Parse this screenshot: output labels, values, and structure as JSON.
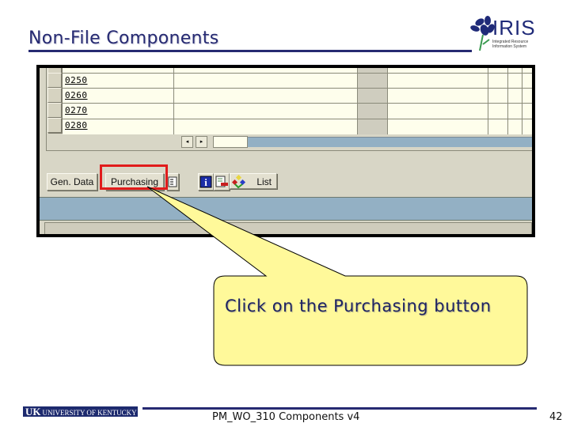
{
  "slide": {
    "title": "Non-File Components",
    "logo": {
      "name": "IRIS",
      "subtitle": "Integrated Resource Information System"
    }
  },
  "sap_screen": {
    "table": {
      "rows": [
        {
          "item": "0250"
        },
        {
          "item": "0260"
        },
        {
          "item": "0270"
        },
        {
          "item": "0280"
        }
      ]
    },
    "scroll": {
      "left_icon": "◂",
      "right_icon": "▸"
    },
    "buttons": {
      "gen_data": "Gen. Data",
      "purchasing": "Purchasing",
      "list": "List"
    },
    "icons": [
      "detail-icon",
      "info-icon",
      "delete-icon",
      "structure-icon"
    ]
  },
  "callout": {
    "text": "Click on the Purchasing button"
  },
  "footer": {
    "logo_abbrev": "UK",
    "logo_text": "UNIVERSITY OF KENTUCKY",
    "document": "PM_WO_310 Components v4",
    "page": "42"
  },
  "colors": {
    "title": "#262a72",
    "highlight": "#e11b1b",
    "callout_fill": "#fff99a",
    "sap_blue": "#93b0c4"
  }
}
